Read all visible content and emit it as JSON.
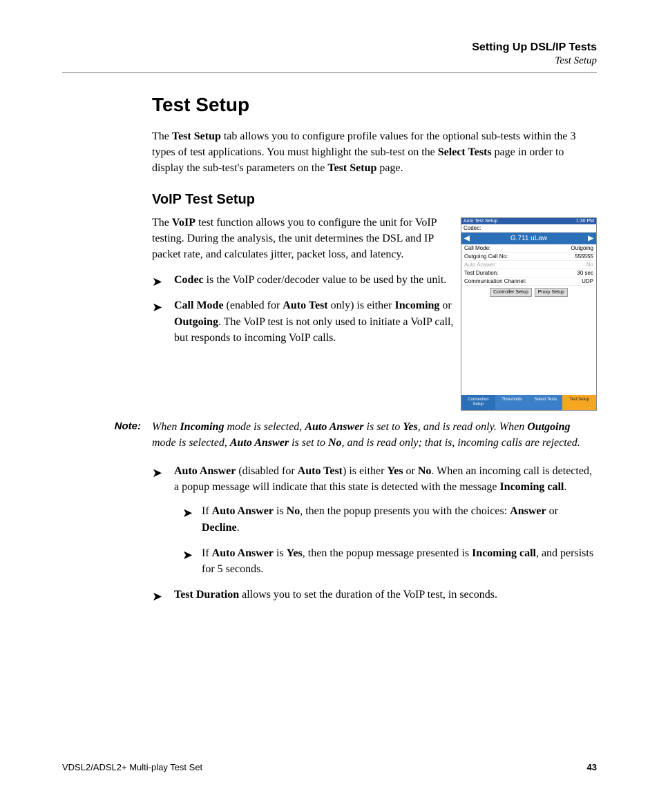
{
  "header": {
    "chapter": "Setting Up DSL/IP Tests",
    "section_name": "Test Setup"
  },
  "section": {
    "title": "Test Setup",
    "intro": {
      "p1_a": "The ",
      "p1_b": "Test Setup",
      "p1_c": " tab allows you to configure profile values for the optional sub-tests within the 3 types of test applications. You must highlight the sub-test on the ",
      "p1_d": "Select Tests",
      "p1_e": " page in order to display the sub-test's parameters on the ",
      "p1_f": "Test Setup",
      "p1_g": " page."
    }
  },
  "subsection": {
    "title": "VoIP Test Setup",
    "p1_a": "The ",
    "p1_b": "VoIP",
    "p1_c": " test function allows you to configure the unit for VoIP testing. During the analysis, the unit determines the DSL and IP packet rate, and calculates jitter, packet loss, and latency.",
    "bullets1": {
      "codec_a": "Codec",
      "codec_b": " is the VoIP coder/decoder value to be used by the unit.",
      "callmode_a": "Call Mode",
      "callmode_b": " (enabled for ",
      "callmode_c": "Auto Test",
      "callmode_d": " only) is either ",
      "callmode_e": "Incoming",
      "callmode_f": " or ",
      "callmode_g": "Outgoing",
      "callmode_h": ". The VoIP test is not only used to initiate a VoIP call, but responds to incoming VoIP calls."
    },
    "note": {
      "label": "Note:",
      "a": "When ",
      "b": "Incoming",
      "c": " mode is selected, ",
      "d": "Auto Answer",
      "e": " is set to ",
      "f": "Yes",
      "g": ", and is read only. When ",
      "h": "Outgoing",
      "i": " mode is selected, ",
      "j": "Auto Answer",
      "k": " is set to ",
      "l": "No",
      "m": ", and is read only; that is, incoming calls are rejected."
    },
    "bullets2": {
      "aa_a": "Auto Answer",
      "aa_b": " (disabled for ",
      "aa_c": "Auto Test",
      "aa_d": ") is either ",
      "aa_e": "Yes",
      "aa_f": " or ",
      "aa_g": "No",
      "aa_h": ". When an incoming call is detected, a popup message will indicate that this state is detected with the message ",
      "aa_i": "Incoming call",
      "aa_j": ".",
      "sub_no_a": "If ",
      "sub_no_b": "Auto Answer",
      "sub_no_c": " is ",
      "sub_no_d": "No",
      "sub_no_e": ", then the popup presents you with the choices: ",
      "sub_no_f": "Answer",
      "sub_no_g": " or ",
      "sub_no_h": "Decline",
      "sub_no_i": ".",
      "sub_yes_a": "If ",
      "sub_yes_b": "Auto Answer",
      "sub_yes_c": " is ",
      "sub_yes_d": "Yes",
      "sub_yes_e": ", then the popup message presented is ",
      "sub_yes_f": "Incoming call",
      "sub_yes_g": ", and persists for 5 seconds.",
      "td_a": "Test Duration",
      "td_b": " allows you to set the duration of the VoIP test, in seconds."
    }
  },
  "figure": {
    "status_left": "Auto Test Setup",
    "status_right": "1:30 PM",
    "codec_label": "Codec:",
    "codec_value": "G.711 uLaw",
    "rows": {
      "call_mode_k": "Call Mode:",
      "call_mode_v": "Outgoing",
      "outgoing_no_k": "Outgoing Call No:",
      "outgoing_no_v": "555555",
      "auto_answer_k": "Auto Answer:",
      "auto_answer_v": "No",
      "test_duration_k": "Test Duration:",
      "test_duration_v": "30 sec",
      "comm_channel_k": "Communication Channel:",
      "comm_channel_v": "UDP"
    },
    "btn1": "Controller Setup",
    "btn2": "Proxy Setup",
    "tabs": {
      "t1": "Connection Setup",
      "t2": "Thresholds",
      "t3": "Select Tests",
      "t4": "Test Setup"
    }
  },
  "footer": {
    "left": "VDSL2/ADSL2+ Multi-play Test Set",
    "page": "43"
  }
}
